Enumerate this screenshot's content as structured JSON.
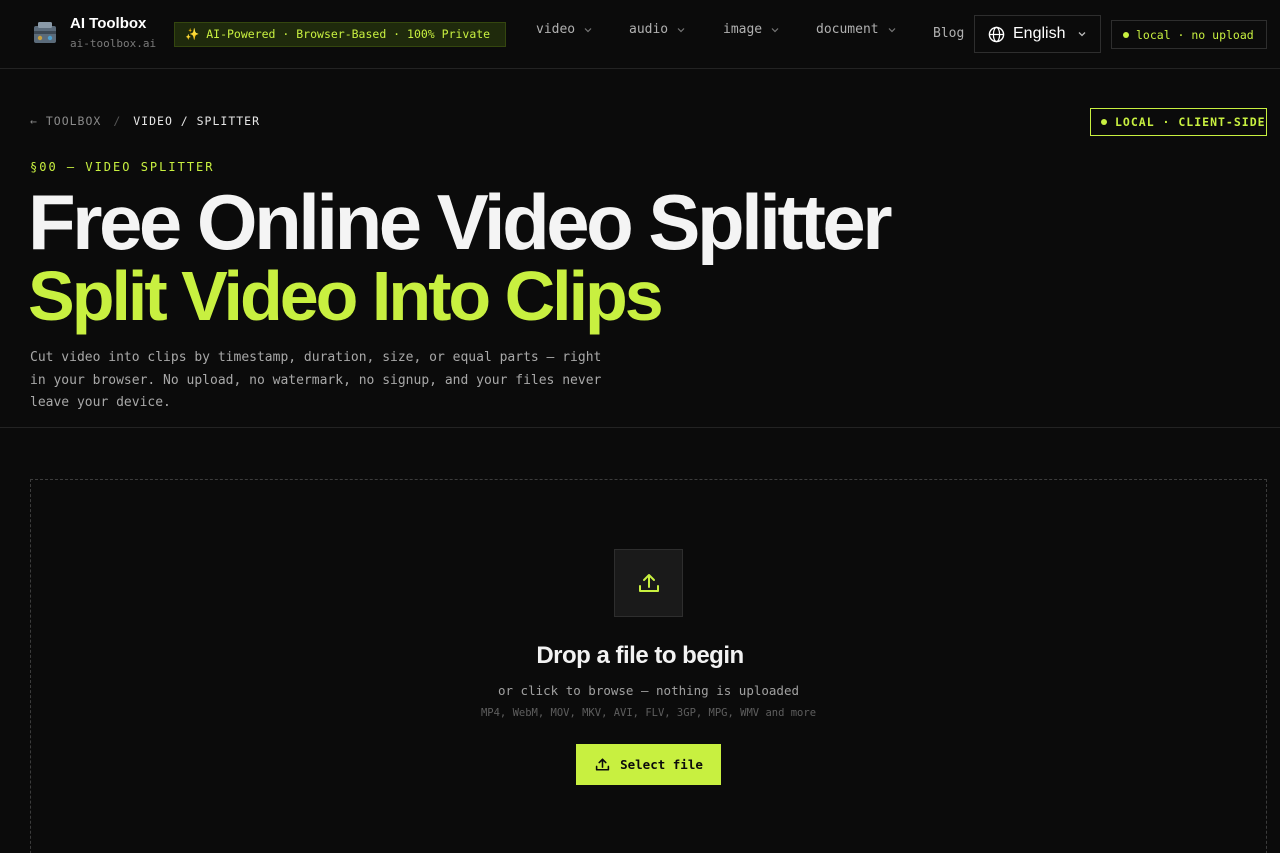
{
  "brand": {
    "name": "AI Toolbox",
    "domain": "ai-toolbox.ai"
  },
  "tagline": "✨ AI-Powered · Browser-Based · 100% Private",
  "nav": {
    "items": [
      {
        "label": "video"
      },
      {
        "label": "audio"
      },
      {
        "label": "image"
      },
      {
        "label": "document"
      }
    ],
    "blog": "Blog",
    "language": "English",
    "status": "local · no upload"
  },
  "breadcrumb": {
    "root": "← TOOLBOX",
    "separator": "/",
    "current": "VIDEO / SPLITTER"
  },
  "badge": "LOCAL · CLIENT-SIDE",
  "section_label": "§00 — VIDEO SPLITTER",
  "hero": {
    "title": "Free Online Video Splitter",
    "subtitle": "Split Video Into Clips",
    "description": "Cut video into clips by timestamp, duration, size, or equal parts — right in your browser. No upload, no watermark, no signup, and your files never leave your device."
  },
  "dropzone": {
    "title": "Drop a file to begin",
    "subtitle": "or click to browse — nothing is uploaded",
    "formats": "MP4, WebM, MOV, MKV, AVI, FLV, 3GP, MPG, WMV and more",
    "button": "Select file",
    "icon": "upload-icon"
  },
  "colors": {
    "accent": "#c8f040",
    "background": "#0b0b0b",
    "border": "#2e2e2e"
  }
}
